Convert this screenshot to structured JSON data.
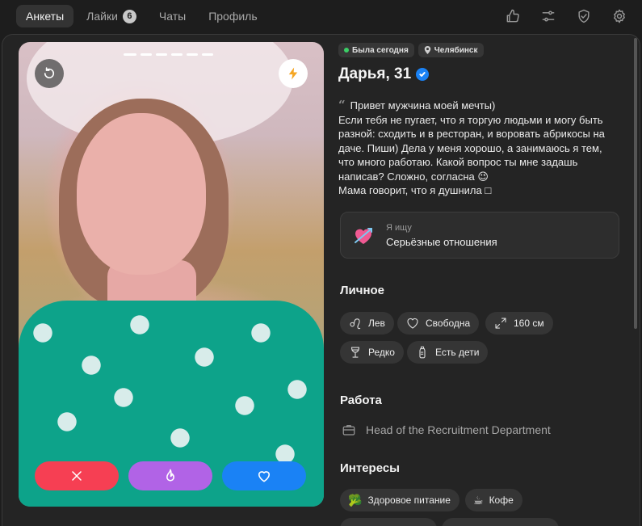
{
  "nav": {
    "tabs": [
      {
        "label": "Анкеты",
        "active": true
      },
      {
        "label": "Лайки",
        "badge": "6"
      },
      {
        "label": "Чаты"
      },
      {
        "label": "Профиль"
      }
    ],
    "icons": [
      "thumbs-up-icon",
      "sliders-icon",
      "shield-check-icon",
      "gear-icon"
    ]
  },
  "photo": {
    "photo_count": 6,
    "current_index": 1
  },
  "profile": {
    "last_seen": "Была сегодня",
    "city": "Челябинск",
    "name_age": "Дарья, 31",
    "verified": true,
    "bio_lines": [
      "Привет мужчина моей мечты)",
      "Если тебя не пугает, что я торгую людьми и могу быть",
      "разной: сходить и в ресторан, и воровать абрикосы на",
      "даче. Пиши) Дела у меня хорошо, а занимаюсь я тем,",
      "что много работаю. Какой вопрос ты мне задашь",
      "написав? Сложно, согласна 😉",
      "Мама говорит, что я душнила □"
    ],
    "looking_for": {
      "label": "Я ищу",
      "value": "Серьёзные отношения",
      "icon": "heart-arrow-icon"
    }
  },
  "personal": {
    "title": "Личное",
    "chips": [
      {
        "label": "Лев",
        "icon": "leo-icon"
      },
      {
        "label": "Свободна",
        "icon": "heart-outline-icon"
      },
      {
        "label": "160 см",
        "icon": "height-arrows-icon"
      },
      {
        "label": "Редко",
        "icon": "wine-glass-icon"
      },
      {
        "label": "Есть дети",
        "icon": "baby-bottle-icon"
      }
    ]
  },
  "work": {
    "title": "Работа",
    "position": "Head of the Recruitment Department",
    "icon": "briefcase-icon"
  },
  "interests": {
    "title": "Интересы",
    "chips": [
      {
        "label": "Здоровое питание",
        "emoji": "🥦"
      },
      {
        "label": "Кофе",
        "emoji": "☕"
      }
    ]
  },
  "colors": {
    "dislike": "#f63f53",
    "superlike": "#b163e6",
    "like": "#1a82f5",
    "verified": "#1a82f5",
    "online": "#3bcf66",
    "boost": "#f5a623"
  }
}
